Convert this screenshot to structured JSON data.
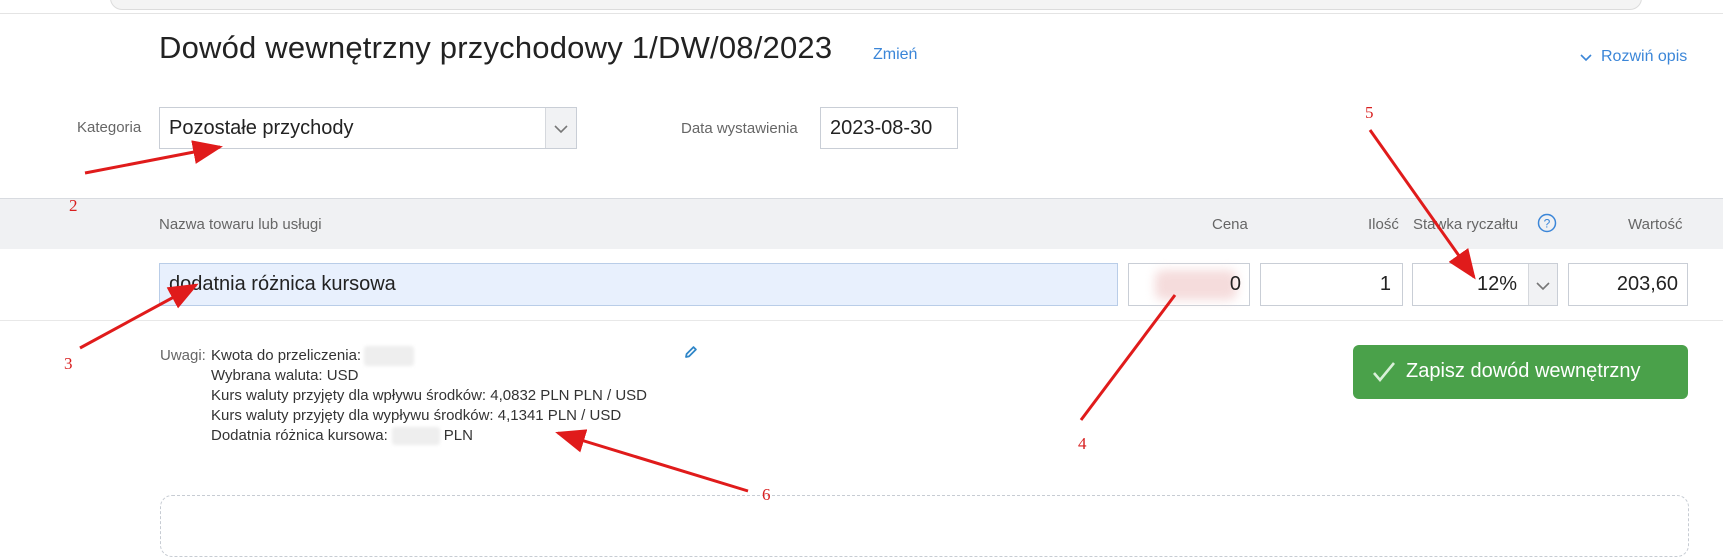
{
  "header": {
    "title": "Dowód wewnętrzny przychodowy 1/DW/08/2023",
    "change_link": "Zmień",
    "expand_link": "Rozwiń opis"
  },
  "form": {
    "category_label": "Kategoria",
    "category_value": "Pozostałe przychody",
    "issue_date_label": "Data wystawienia",
    "issue_date_value": "2023-08-30"
  },
  "table": {
    "columns": {
      "name": "Nazwa towaru lub usługi",
      "price": "Cena",
      "quantity": "Ilość",
      "rate": "Stawka ryczałtu",
      "value": "Wartość"
    },
    "row": {
      "name": "dodatnia różnica kursowa",
      "price_visible_suffix": "0",
      "quantity": "1",
      "rate": "12%",
      "value": "203,60"
    }
  },
  "notes": {
    "label": "Uwagi:",
    "lines": [
      "Kwota do przeliczenia:",
      "Wybrana waluta: USD",
      "Kurs waluty przyjęty dla wpływu środków: 4,0832 PLN PLN / USD",
      "Kurs waluty przyjęty dla wypływu środków: 4,1341 PLN / USD",
      "Dodatnia różnica kursowa:"
    ],
    "currency_suffix": "PLN"
  },
  "actions": {
    "save_label": "Zapisz dowód wewnętrzny"
  },
  "annotations": {
    "color": "#e01b1b",
    "labels": [
      "2",
      "3",
      "4",
      "5",
      "6"
    ]
  }
}
